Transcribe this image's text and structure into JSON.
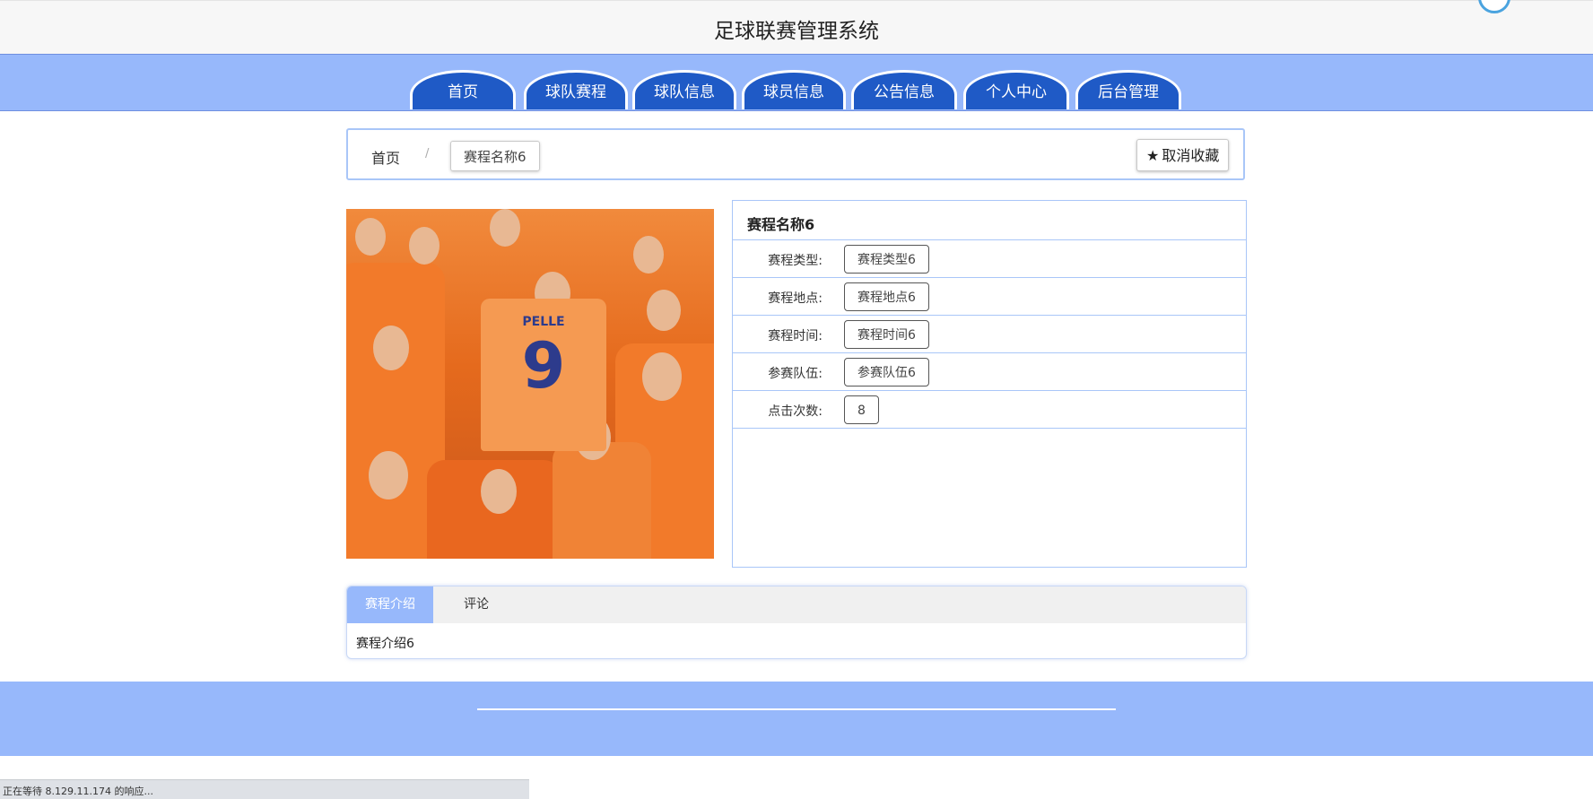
{
  "header": {
    "site_title": "足球联赛管理系统"
  },
  "nav": {
    "items": [
      {
        "label": "首页"
      },
      {
        "label": "球队赛程"
      },
      {
        "label": "球队信息"
      },
      {
        "label": "球员信息"
      },
      {
        "label": "公告信息"
      },
      {
        "label": "个人中心"
      },
      {
        "label": "后台管理"
      }
    ]
  },
  "breadcrumb": {
    "home": "首页",
    "separator": "/",
    "current": "赛程名称6",
    "favorite_button": "取消收藏",
    "favorite_icon": "star-icon"
  },
  "photo": {
    "jersey_name": "PELLE",
    "jersey_number": "9"
  },
  "detail": {
    "title": "赛程名称6",
    "fields": [
      {
        "label": "赛程类型:",
        "value": "赛程类型6"
      },
      {
        "label": "赛程地点:",
        "value": "赛程地点6"
      },
      {
        "label": "赛程时间:",
        "value": "赛程时间6"
      },
      {
        "label": "参赛队伍:",
        "value": "参赛队伍6"
      },
      {
        "label": "点击次数:",
        "value": "8"
      }
    ]
  },
  "tabs": {
    "items": [
      {
        "label": "赛程介绍",
        "active": true
      },
      {
        "label": "评论",
        "active": false
      }
    ],
    "content": "赛程介绍6"
  },
  "status_bar": {
    "text": "正在等待 8.129.11.174 的响应..."
  },
  "colors": {
    "nav_background": "#97b8fb",
    "nav_tab": "#1f5ac6",
    "panel_border": "#a9c6f8",
    "footer": "#97b8fb"
  }
}
